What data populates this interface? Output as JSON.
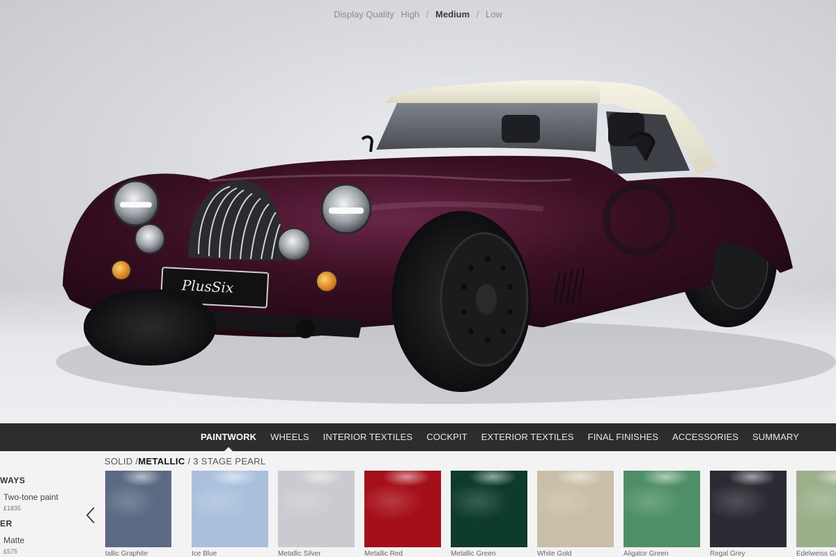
{
  "display_quality": {
    "label": "Display Quality",
    "options": [
      "High",
      "Medium",
      "Low"
    ],
    "selected": "Medium"
  },
  "car": {
    "plate_text": "PlusSix",
    "body_color": "#3b0f24",
    "roof_color": "#ece8d6"
  },
  "nav": {
    "items": [
      "PAINTWORK",
      "WHEELS",
      "INTERIOR TEXTILES",
      "COCKPIT",
      "EXTERIOR TEXTILES",
      "FINAL FINISHES",
      "ACCESSORIES",
      "SUMMARY"
    ],
    "active": "PAINTWORK"
  },
  "subtabs": {
    "items": [
      "SOLID",
      "METALLIC",
      "3 STAGE PEARL"
    ],
    "active": "METALLIC",
    "separator": "/"
  },
  "left_options": {
    "group1_heading": "WAYS",
    "group1_item": "Two-tone paint",
    "group1_price": "£1835",
    "group2_heading": "ER",
    "group2_item": "Matte",
    "group2_price": "£575"
  },
  "swatches": [
    {
      "name": "tallic Graphite",
      "color": "#5b6a82"
    },
    {
      "name": "Ice Blue",
      "color": "#a9c0dc"
    },
    {
      "name": "Metallic Silver",
      "color": "#c9cbd0"
    },
    {
      "name": "Metallic Red",
      "color": "#a50f18"
    },
    {
      "name": "Metallic Green",
      "color": "#0d3b2c"
    },
    {
      "name": "White Gold",
      "color": "#c9bfa6"
    },
    {
      "name": "Aligator Green",
      "color": "#4f8f68"
    },
    {
      "name": "Regal Grey",
      "color": "#2a2b33"
    },
    {
      "name": "Edelweiss Green",
      "color": "#9bb08a"
    }
  ],
  "icons": {
    "prev": "chevron-left-icon"
  }
}
